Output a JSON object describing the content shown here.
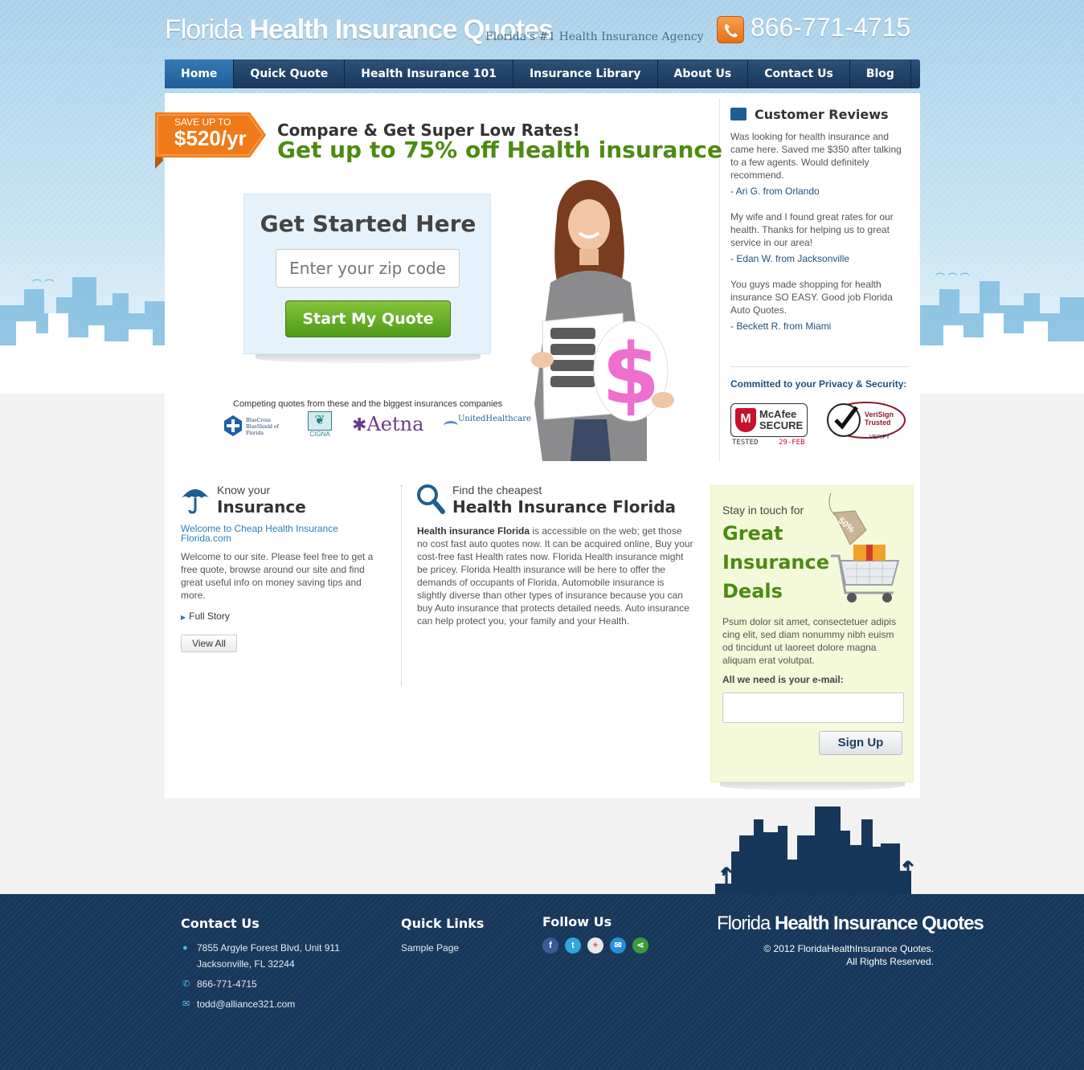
{
  "header": {
    "logo_light": "Florida ",
    "logo_bold": "Health Insurance Quotes",
    "tagline": "Florida's #1 Health Insurance Agency",
    "phone": "866-771-4715"
  },
  "nav": {
    "items": [
      "Home",
      "Quick Quote",
      "Health Insurance 101",
      "Insurance Library",
      "About Us",
      "Contact Us",
      "Blog"
    ],
    "active": "Home"
  },
  "hero": {
    "badge_top": "SAVE UP TO",
    "badge_amount": "$520/yr",
    "compare": "Compare & Get Super Low Rates!",
    "offer": "Get up to 75% off Health insurance",
    "form_title": "Get Started Here",
    "zip_placeholder": "Enter your zip code",
    "quote_button": "Start My Quote",
    "competing": "Competing quotes from these and the biggest insurances companies",
    "partners": [
      "BlueCross BlueShield of Florida",
      "CIGNA",
      "Aetna",
      "UnitedHealthcare"
    ]
  },
  "reviews": {
    "title": "Customer Reviews",
    "items": [
      {
        "text": "Was looking for health insurance and came here. Saved me $350 after talking to a few agents. Would definitely recommend.",
        "by": "- Ari G. from Orlando"
      },
      {
        "text": "My wife and I found great rates for our health. Thanks for helping us to great service in our area!",
        "by": "- Edan W. from Jacksonville"
      },
      {
        "text": "You guys made shopping for health insurance SO EASY. Good job Florida Auto Quotes.",
        "by": "- Beckett R. from Miami"
      }
    ],
    "privacy": "Committed to your Privacy & Security:",
    "mcafee": {
      "brand": "McAfee",
      "secure": "SECURE",
      "tested": "TESTED",
      "date": "29-FEB"
    },
    "verisign": {
      "name": "VeriSign",
      "trusted": "Trusted",
      "verify": "VERIFY"
    }
  },
  "know": {
    "small": "Know your",
    "big": "Insurance",
    "link": "Welcome to Cheap Health Insurance Florida.com",
    "text": "Welcome to our site. Please feel free to get a free quote, browse around our site and find great useful info on money saving tips and more.",
    "full_story": "Full Story",
    "view_all": "View All"
  },
  "find": {
    "small": "Find the cheapest",
    "big": "Health Insurance Florida",
    "lead": "Health insurance Florida",
    "text": " is accessible on the web; get those no cost fast auto quotes now. It can be acquired online, Buy your cost-free fast Health rates now.  Florida Health insurance might be pricey.  Florida Health insurance will be here to offer the demands of occupants of Florida.  Automobile insurance is slightly diverse than other types of insurance because you can buy Auto insurance that protects detailed needs.  Auto insurance can help protect you, your family and your Health."
  },
  "newsletter": {
    "stay": "Stay in touch for",
    "deals_line1": "Great",
    "deals_line2": "Insurance",
    "deals_line3": "Deals",
    "tag": "50%",
    "text": "Psum dolor sit amet, consectetuer adipis cing elit, sed diam nonummy nibh euism od tincidunt ut laoreet dolore magna aliquam erat volutpat.",
    "email_label": "All we need is your e-mail:",
    "signup": "Sign Up"
  },
  "footer": {
    "contact_title": "Contact Us",
    "address1": "7855 Argyle Forest Blvd, Unit 911",
    "address2": "Jacksonville, FL 32244",
    "phone": "866-771-4715",
    "email": "todd@alliance321.com",
    "links_title": "Quick Links",
    "links": [
      "Sample Page"
    ],
    "follow_title": "Follow Us",
    "social": [
      "facebook-icon",
      "twitter-icon",
      "google-icon",
      "email-icon",
      "share-icon"
    ],
    "logo_light": "Florida ",
    "logo_bold": "Health Insurance Quotes",
    "copyright1": "© 2012 FloridaHealthInsurance Quotes.",
    "copyright2": "All Rights Reserved."
  },
  "colors": {
    "nav": "#17375a",
    "accent_green": "#4d8a13",
    "orange": "#ef7a1a",
    "link_blue": "#2a7fc0",
    "footer": "#17375a"
  }
}
